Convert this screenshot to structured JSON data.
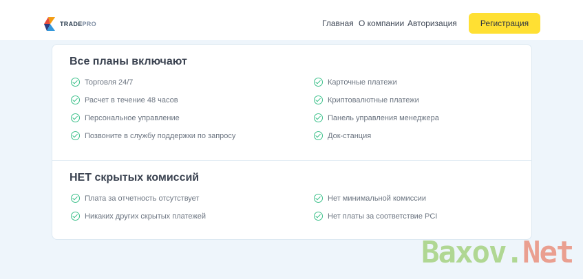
{
  "header": {
    "logo": {
      "brand_bold": "TRADE",
      "brand_light": "PRO"
    },
    "nav": [
      "Главная",
      "О компании",
      "Авторизация"
    ],
    "register_label": "Регистрация"
  },
  "sections": [
    {
      "title": "Все планы включают",
      "left": [
        "Торговля 24/7",
        "Расчет в течение 48 часов",
        "Персональное управление",
        "Позвоните в службу поддержки по запросу"
      ],
      "right": [
        "Карточные платежи",
        "Криптовалютные платежи",
        "Панель управления менеджера",
        "Док-станция"
      ]
    },
    {
      "title": "НЕТ скрытых комиссий",
      "left": [
        "Плата за отчетность отсутствует",
        "Никаких других скрытых платежей"
      ],
      "right": [
        "Нет минимальной комиссии",
        "Нет платы за соответствие PCI"
      ]
    }
  ],
  "watermark": {
    "part1": "Baxov.",
    "part2": "Net"
  },
  "colors": {
    "accent_yellow": "#ffe033",
    "check_green": "#3cc08a"
  }
}
